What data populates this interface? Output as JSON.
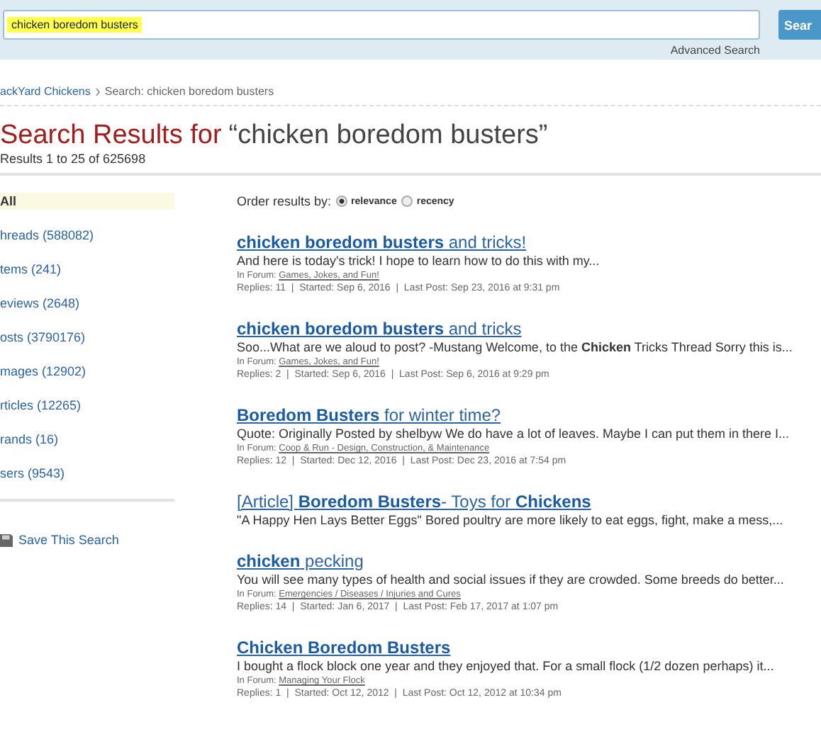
{
  "search": {
    "value": "chicken boredom busters",
    "button": "Sear",
    "advanced": "Advanced Search"
  },
  "breadcrumb": [
    {
      "label": "ackYard Chickens",
      "kind": "link"
    },
    {
      "label": "Search: chicken boredom busters",
      "kind": "current"
    }
  ],
  "heading": {
    "title": "Search Results for",
    "query": "“chicken boredom busters”",
    "count": "Results 1 to 25 of 625698"
  },
  "filters": [
    {
      "label": "All",
      "selected": true
    },
    {
      "label": "hreads (588082)",
      "selected": false
    },
    {
      "label": "tems (241)",
      "selected": false
    },
    {
      "label": "eviews (2648)",
      "selected": false
    },
    {
      "label": "osts (3790176)",
      "selected": false
    },
    {
      "label": "mages (12902)",
      "selected": false
    },
    {
      "label": "rticles (12265)",
      "selected": false
    },
    {
      "label": "rands (16)",
      "selected": false
    },
    {
      "label": "sers (9543)",
      "selected": false
    }
  ],
  "save_search": "Save This Search",
  "order": {
    "label": "Order results by:",
    "options": [
      {
        "label": "relevance",
        "selected": true
      },
      {
        "label": "recency",
        "selected": false
      }
    ]
  },
  "results": [
    {
      "kind": "thread",
      "title": "**chicken boredom busters** and tricks!",
      "snippet": "And here is today's trick! I hope to learn how to do this with my...",
      "forum_label": "In Forum:",
      "forum": "Games, Jokes, and Fun!",
      "meta": "Replies: 11  |  Started: Sep 6, 2016  |  Last Post: Sep 23, 2016 at 9:31 pm"
    },
    {
      "kind": "thread",
      "title": "**chicken boredom busters** and tricks",
      "snippet": "Soo...What are we aloud to post?    -Mustang Welcome, to the **Chicken** Tricks Thread Sorry this is...",
      "forum_label": "In Forum:",
      "forum": "Games, Jokes, and Fun!",
      "meta": "Replies: 2  |  Started: Sep 6, 2016  |  Last Post: Sep 6, 2016 at 9:29 pm"
    },
    {
      "kind": "thread",
      "title": "**Boredom Busters** for winter time?",
      "snippet": "Quote: Originally Posted by shelbyw  We do have a lot of leaves. Maybe I can put them in there I...",
      "forum_label": "In Forum:",
      "forum": "Coop & Run - Design, Construction, & Maintenance",
      "meta": "Replies: 12  |  Started: Dec 12, 2016  |  Last Post: Dec 23, 2016 at 7:54 pm"
    },
    {
      "kind": "article",
      "title": "[Article] **Boredom Busters**- Toys for **Chickens**",
      "snippet": "\"A Happy Hen Lays Better Eggs\" Bored poultry are more likely to eat eggs, fight, make a mess,..."
    },
    {
      "kind": "thread",
      "title": "**chicken** pecking",
      "snippet": "You will see many types of health and social issues if they are crowded. Some breeds do better...",
      "forum_label": "In Forum:",
      "forum": "Emergencies / Diseases / Injuries and Cures",
      "meta": "Replies: 14  |  Started: Jan 6, 2017  |  Last Post: Feb 17, 2017 at 1:07 pm"
    },
    {
      "kind": "thread",
      "title": "**Chicken Boredom Busters**",
      "snippet": "I bought a flock block one year and they enjoyed that.  For a small flock (1/2 dozen perhaps) it...",
      "forum_label": "In Forum:",
      "forum": "Managing Your Flock",
      "meta": "Replies: 1  |  Started: Oct 12, 2012  |  Last Post: Oct 12, 2012 at 10:34 pm"
    }
  ]
}
